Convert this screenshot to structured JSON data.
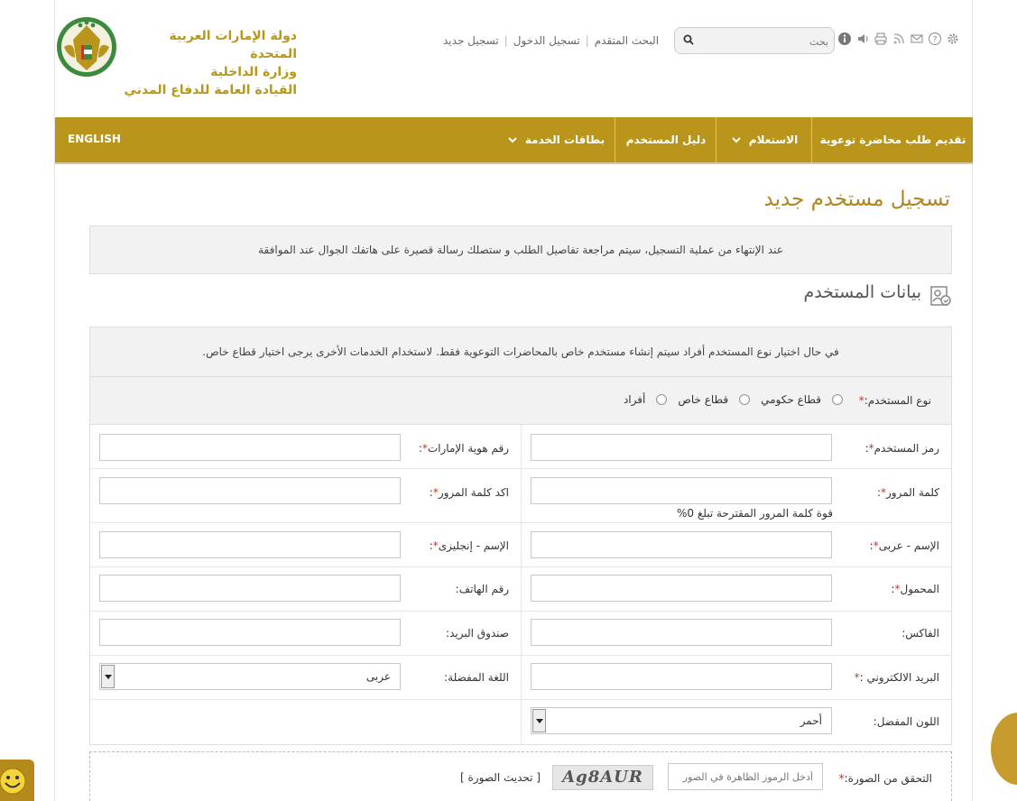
{
  "org": {
    "line1": "دولة الإمارات العربية المتحدة",
    "line2": "وزارة الداخلية",
    "line3": "القيادة العامة للدفاع المدني"
  },
  "top_links": {
    "register": "تسجيل جديد",
    "login": "تسجيل الدخول",
    "advanced_search": "البحث المتقدم"
  },
  "search": {
    "placeholder": "بحث"
  },
  "tools": [
    "info-icon",
    "speaker-icon",
    "print-icon",
    "rss-icon",
    "mail-icon",
    "help-icon",
    "settings-icon"
  ],
  "nav": {
    "english": "ENGLISH",
    "items": [
      "تقديم طلب محاضرة توعوية",
      "الاستعلام",
      "دليل المستخدم",
      "بطاقات الخدمة"
    ]
  },
  "page": {
    "title": "تسجيل مستخدم جديد",
    "notice": "عند الإنتهاء من عملية التسجيل، سيتم مراجعة تفاصيل الطلب و ستصلك رسالة قصيرة على هاتفك الجوال عند الموافقة",
    "section_title": "بيانات المستخدم"
  },
  "form": {
    "info": "في حال اختيار نوع المستخدم أفراد سيتم إنشاء مستخدم خاص بالمحاضرات التوعوية فقط. لاستخدام الخدمات الأخرى يرجى اختيار قطاع خاص.",
    "user_type_label": "نوع المستخدم:",
    "user_types": [
      "قطاع حكومي",
      "قطاع خاص",
      "أفراد"
    ],
    "required_mark": "*",
    "username": "رمز المستخدم",
    "emirates_id": "رقم هوية الإمارات",
    "password": "كلمة المرور",
    "confirm_password": "اكد كلمة المرور",
    "password_strength": "قوة كلمة المرور المقترحة تبلغ 0%",
    "name_ar": "الإسم - عربى",
    "name_en": "الإسم - إنجليزى",
    "mobile": "المحمول",
    "phone": "رقم الهاتف:",
    "fax": "الفاكس:",
    "po_box": "صندوق البريد:",
    "email": "البريد الالكتروني :",
    "language_label": "اللغة المفضلة:",
    "language_value": "عربى",
    "color_label": "اللون المفضل:",
    "color_value": "أحمر"
  },
  "captcha": {
    "label": "التحقق من الصورة:",
    "placeholder": "أدخل الرموز الظاهرة في الصور",
    "code": "Ag8AUR",
    "refresh": "[ تحديث الصورة ]"
  },
  "colors": {
    "gold": "#b9961b",
    "title": "#b1841e",
    "required": "#c0392b"
  }
}
